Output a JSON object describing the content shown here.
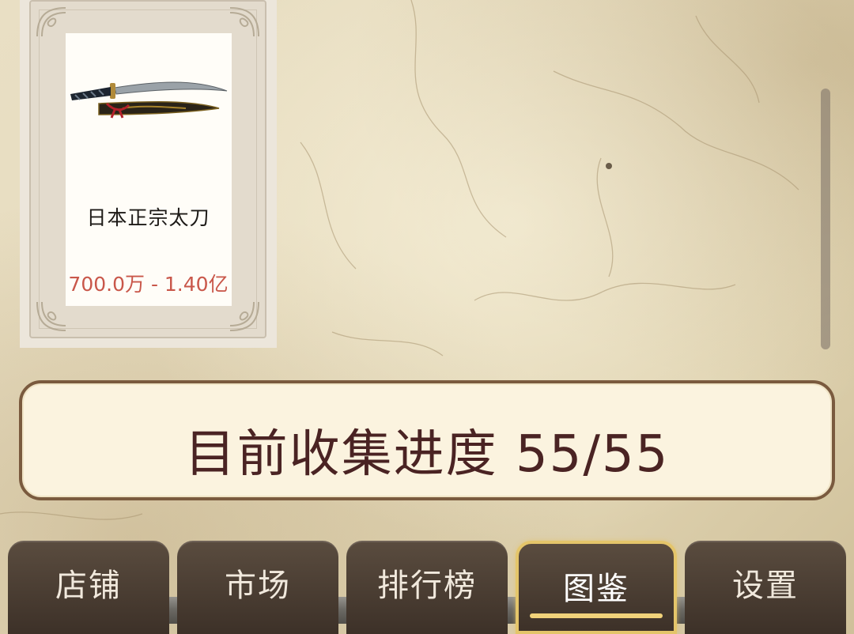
{
  "item_card": {
    "name": "日本正宗太刀",
    "price_range": "700.0万 - 1.40亿",
    "image_icon": "katana-icon"
  },
  "collection": {
    "progress_label": "目前收集进度 55/55",
    "collected": 55,
    "total": 55
  },
  "nav": {
    "tabs": [
      {
        "label": "店铺",
        "active": false
      },
      {
        "label": "市场",
        "active": false
      },
      {
        "label": "排行榜",
        "active": false
      },
      {
        "label": "图鉴",
        "active": true
      },
      {
        "label": "设置",
        "active": false
      }
    ]
  },
  "colors": {
    "price": "#c9574a",
    "progress_text": "#4a2323",
    "active_tab_border": "#e4c56a"
  }
}
